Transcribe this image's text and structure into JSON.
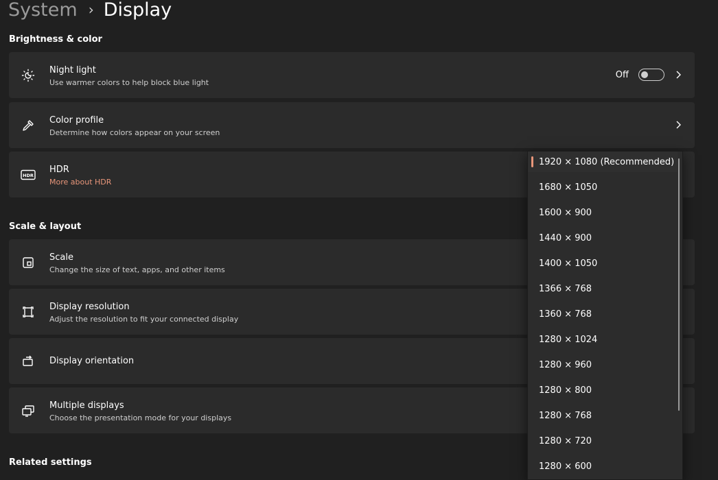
{
  "breadcrumb": {
    "parent": "System",
    "current": "Display"
  },
  "brightness_section": {
    "title": "Brightness & color",
    "night_light": {
      "title": "Night light",
      "subtitle": "Use warmer colors to help block blue light",
      "toggle_label": "Off",
      "toggle_on": false
    },
    "color_profile": {
      "title": "Color profile",
      "subtitle": "Determine how colors appear on your screen"
    },
    "hdr": {
      "title": "HDR",
      "link": "More about HDR"
    }
  },
  "scale_section": {
    "title": "Scale & layout",
    "scale": {
      "title": "Scale",
      "subtitle": "Change the size of text, apps, and other items"
    },
    "resolution": {
      "title": "Display resolution",
      "subtitle": "Adjust the resolution to fit your connected display"
    },
    "orientation": {
      "title": "Display orientation"
    },
    "multiple": {
      "title": "Multiple displays",
      "subtitle": "Choose the presentation mode for your displays"
    }
  },
  "related_section": {
    "title": "Related settings"
  },
  "resolution_dropdown": {
    "selected_index": 0,
    "options": [
      "1920 × 1080 (Recommended)",
      "1680 × 1050",
      "1600 × 900",
      "1440 × 900",
      "1400 × 1050",
      "1366 × 768",
      "1360 × 768",
      "1280 × 1024",
      "1280 × 960",
      "1280 × 800",
      "1280 × 768",
      "1280 × 720",
      "1280 × 600"
    ]
  },
  "colors": {
    "accent": "#e8967a",
    "background": "#202020",
    "card": "#2b2b2b"
  }
}
